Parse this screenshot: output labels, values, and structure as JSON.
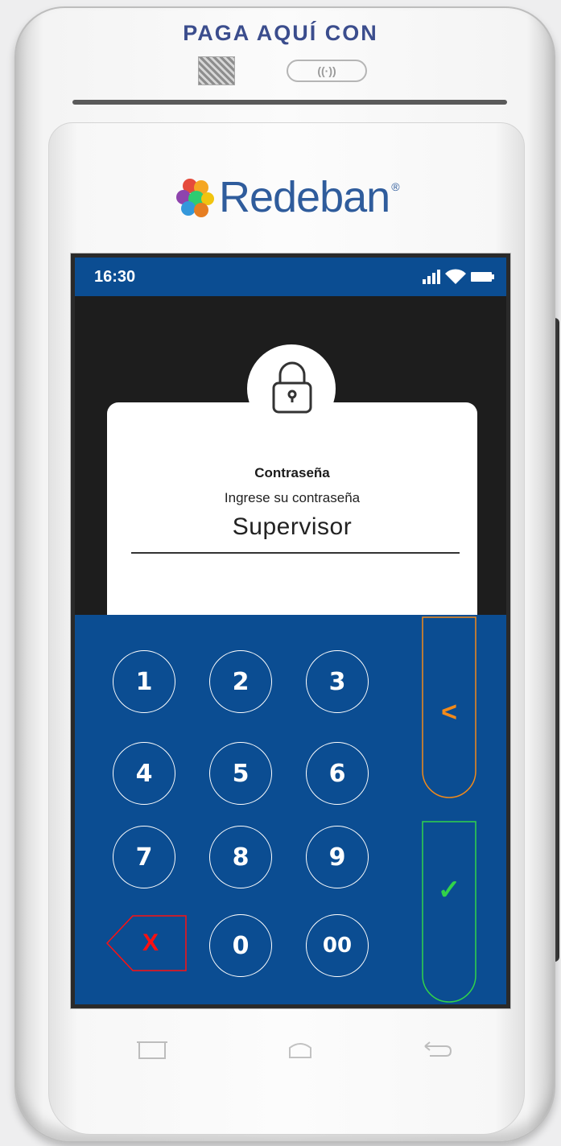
{
  "device": {
    "banner": "PAGA AQUÍ CON",
    "contactless_label": "((·))",
    "brand": "Redeban",
    "brand_reg": "®"
  },
  "status_bar": {
    "time": "16:30",
    "icons": [
      "signal-icon",
      "wifi-icon",
      "battery-icon"
    ]
  },
  "dialog": {
    "icon": "lock-icon",
    "title": "Contraseña",
    "subtitle": "Ingrese su contraseña",
    "value": "Supervisor"
  },
  "keypad": {
    "keys": [
      "1",
      "2",
      "3",
      "4",
      "5",
      "6",
      "7",
      "8",
      "9",
      "0",
      "00"
    ],
    "clear_label": "X",
    "back_label": "<",
    "confirm_label": "✓"
  },
  "colors": {
    "status_bar": "#0b4d92",
    "keypad_bg": "#0b4d92",
    "back_accent": "#f28a1a",
    "confirm_accent": "#31d34a",
    "clear_accent": "#ff1010",
    "brand_blue": "#2f5c9c"
  },
  "nav_icons": [
    "recent-apps-icon",
    "home-icon",
    "back-icon"
  ]
}
